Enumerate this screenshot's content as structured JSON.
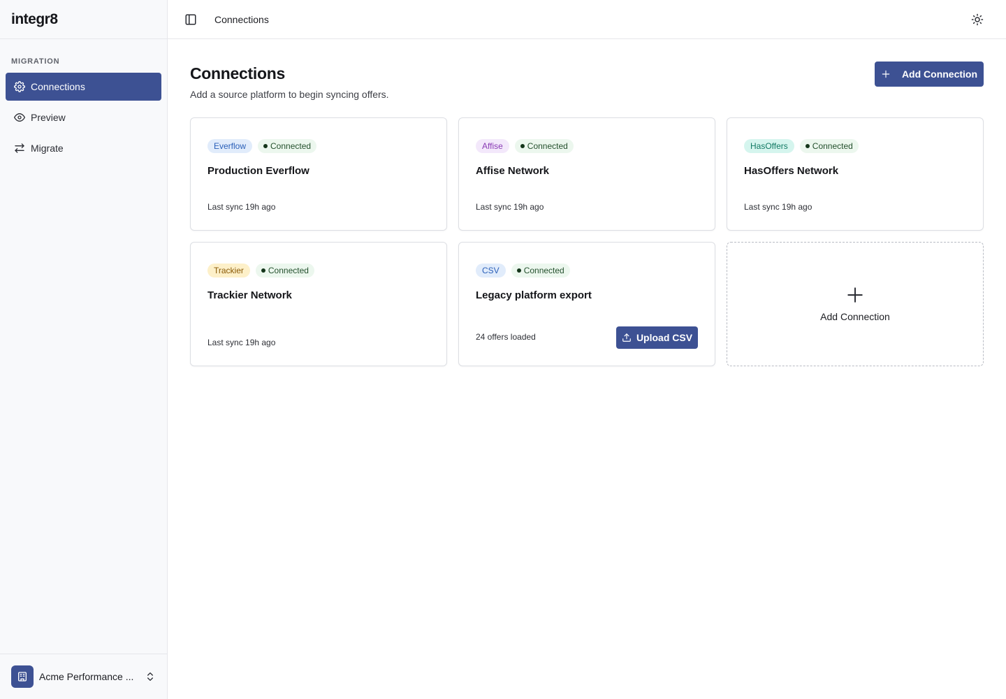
{
  "app": {
    "logo": "integr8"
  },
  "sidebar": {
    "section_label": "MIGRATION",
    "items": [
      {
        "label": "Connections",
        "icon": "gear-icon",
        "active": true
      },
      {
        "label": "Preview",
        "icon": "eye-icon",
        "active": false
      },
      {
        "label": "Migrate",
        "icon": "arrows-swap-icon",
        "active": false
      }
    ],
    "org": {
      "name": "Acme Performance ...",
      "icon": "building-icon"
    }
  },
  "topbar": {
    "breadcrumb": "Connections"
  },
  "page": {
    "title": "Connections",
    "subtitle": "Add a source platform to begin syncing offers.",
    "add_button": "Add Connection"
  },
  "cards": [
    {
      "platform": "Everflow",
      "status": "Connected",
      "name": "Production Everflow",
      "footer": "Last sync 19h ago"
    },
    {
      "platform": "Affise",
      "status": "Connected",
      "name": "Affise Network",
      "footer": "Last sync 19h ago"
    },
    {
      "platform": "HasOffers",
      "status": "Connected",
      "name": "HasOffers Network",
      "footer": "Last sync 19h ago"
    },
    {
      "platform": "Trackier",
      "status": "Connected",
      "name": "Trackier Network",
      "footer": "Last sync 19h ago"
    },
    {
      "platform": "CSV",
      "status": "Connected",
      "name": "Legacy platform export",
      "footer": "24 offers loaded",
      "action": "Upload CSV"
    }
  ],
  "add_card": {
    "label": "Add Connection"
  },
  "colors": {
    "accent": "#3d5193",
    "status_bg": "#ecf7ee",
    "status_dot": "#14351a"
  }
}
